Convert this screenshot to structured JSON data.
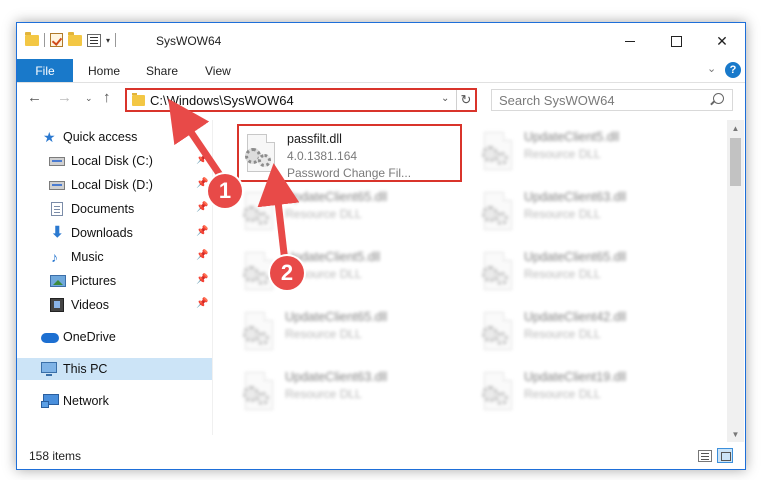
{
  "window": {
    "title": "SysWOW64",
    "controls": {
      "minimize": "",
      "maximize": "",
      "close": "✕"
    }
  },
  "ribbon": {
    "tabs": [
      "File",
      "Home",
      "Share",
      "View"
    ],
    "help": "?",
    "collapse": "⌄"
  },
  "nav": {
    "back": "←",
    "forward": "→",
    "recent": "⌄",
    "up": "↑",
    "address": "C:\\Windows\\SysWOW64",
    "address_dropdown": "⌄",
    "refresh": "↻",
    "search_placeholder": "Search SysWOW64"
  },
  "sidebar": {
    "items": [
      {
        "label": "Quick access",
        "icon": "star-icon",
        "pinned": false
      },
      {
        "label": "Local Disk (C:)",
        "icon": "disk-icon",
        "pinned": true
      },
      {
        "label": "Local Disk (D:)",
        "icon": "disk-icon",
        "pinned": true
      },
      {
        "label": "Documents",
        "icon": "documents-icon",
        "pinned": true
      },
      {
        "label": "Downloads",
        "icon": "downloads-icon",
        "pinned": true
      },
      {
        "label": "Music",
        "icon": "music-icon",
        "pinned": true
      },
      {
        "label": "Pictures",
        "icon": "pictures-icon",
        "pinned": true
      },
      {
        "label": "Videos",
        "icon": "videos-icon",
        "pinned": true
      },
      {
        "label": "OneDrive",
        "icon": "onedrive-icon",
        "pinned": false
      },
      {
        "label": "This PC",
        "icon": "this-pc-icon",
        "pinned": false,
        "selected": true
      },
      {
        "label": "Network",
        "icon": "network-icon",
        "pinned": false
      }
    ],
    "pin_glyph": "📌"
  },
  "files": [
    {
      "name": "passfilt.dll",
      "version": "4.0.1381.164",
      "description": "Password Change Fil...",
      "highlighted": true
    },
    {
      "name": "UpdateClient5.dll",
      "description": "Resource DLL"
    },
    {
      "name": "UpdateClient65.dll",
      "description": "Resource DLL"
    },
    {
      "name": "UpdateClient63.dll",
      "description": "Resource DLL"
    },
    {
      "name": "UpdateClient5.dll",
      "description": "Resource DLL"
    },
    {
      "name": "UpdateClient65.dll",
      "description": "Resource DLL"
    },
    {
      "name": "UpdateClient65.dll",
      "description": "Resource DLL"
    },
    {
      "name": "UpdateClient42.dll",
      "description": "Resource DLL"
    },
    {
      "name": "UpdateClient63.dll",
      "description": "Resource DLL"
    },
    {
      "name": "UpdateClient19.dll",
      "description": "Resource DLL"
    }
  ],
  "status": {
    "item_count": "158 items"
  },
  "annotations": {
    "step1": "1",
    "step2": "2",
    "color": "#e84a48"
  }
}
